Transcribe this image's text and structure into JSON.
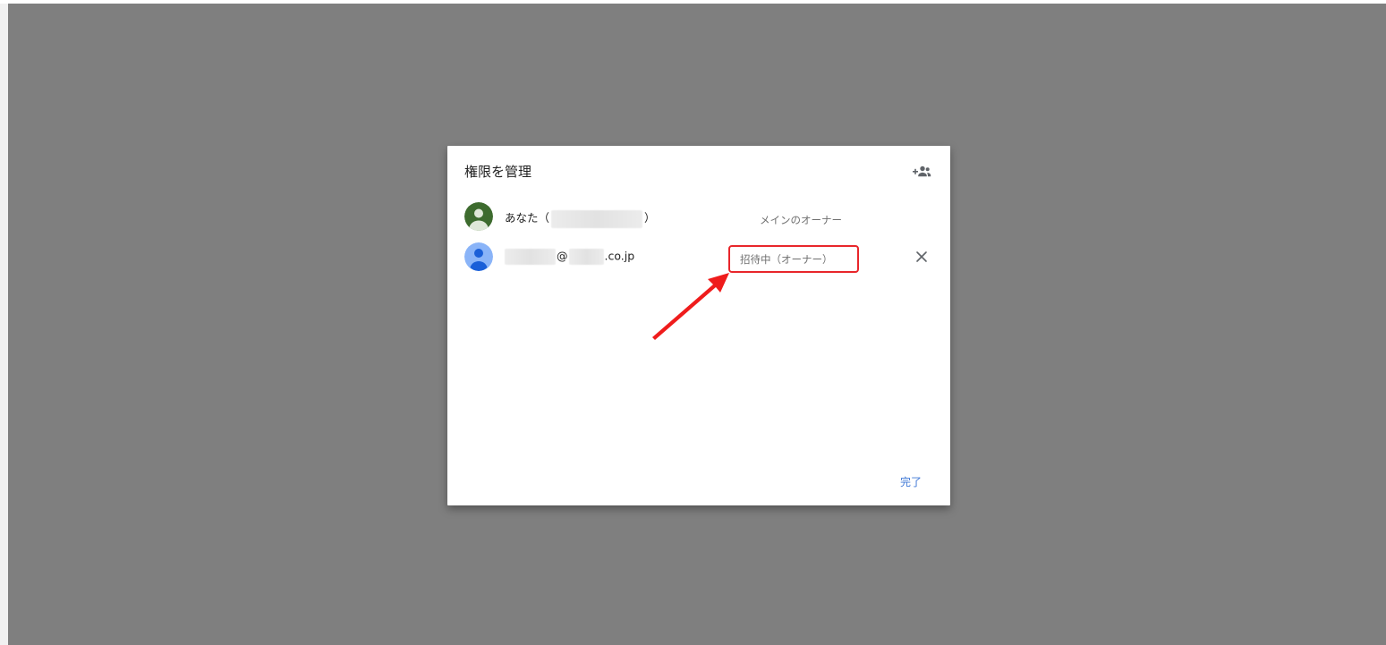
{
  "dialog": {
    "title": "権限を管理",
    "add_people_icon": "person-add-icon",
    "done_label": "完了"
  },
  "permissions": [
    {
      "prefix": "あなた（",
      "suffix": "）",
      "role": "メインのオーナー",
      "avatar_color": "#3d6b2e"
    },
    {
      "at": "@",
      "domain_suffix": ".co.jp",
      "role": "招待中（オーナー）",
      "avatar_color": "#8ab4f8",
      "remove_icon": "close-icon"
    }
  ],
  "annotation": {
    "highlight_color": "#e8262b",
    "arrow_color": "#ef1c1c"
  }
}
